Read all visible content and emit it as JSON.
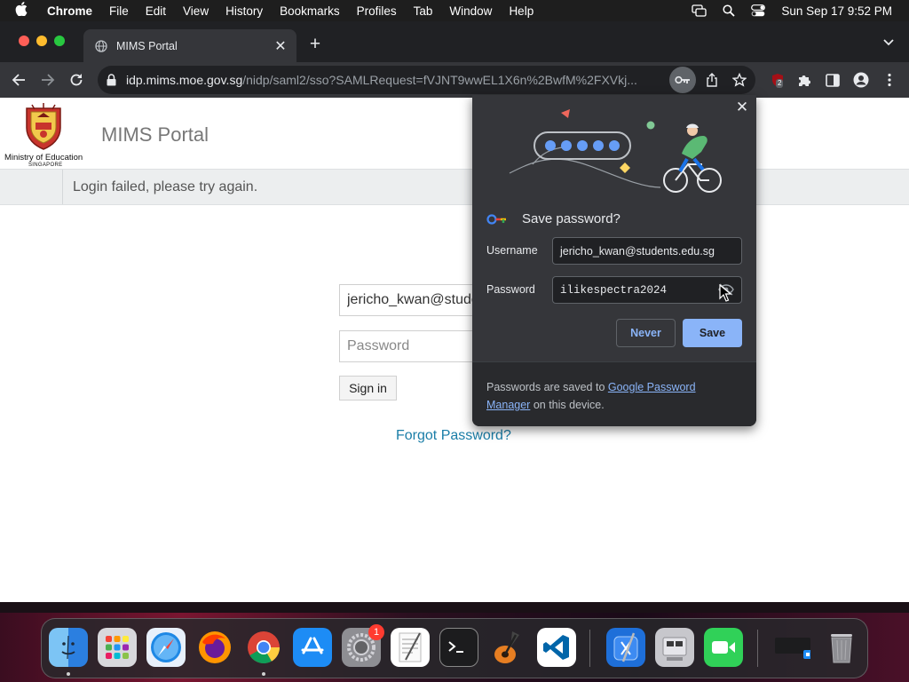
{
  "menubar": {
    "app_name": "Chrome",
    "items": [
      "File",
      "Edit",
      "View",
      "History",
      "Bookmarks",
      "Profiles",
      "Tab",
      "Window",
      "Help"
    ],
    "clock": "Sun Sep 17  9:52 PM"
  },
  "browser": {
    "tab_title": "MIMS Portal",
    "url_host": "idp.mims.moe.gov.sg",
    "url_path": "/nidp/saml2/sso?SAMLRequest=fVJNT9wwEL1X6n%2BwfM%2FXVkj...",
    "extension_badge": "2"
  },
  "page": {
    "org_name": "Ministry of Education",
    "org_country": "SINGAPORE",
    "portal_title": "MIMS Portal",
    "alert": "Login failed, please try again.",
    "username_value": "jericho_kwan@students.edu.sg",
    "password_placeholder": "Password",
    "signin_label": "Sign in",
    "forgot_label": "Forgot Password?"
  },
  "save_password_popup": {
    "title": "Save password?",
    "username_label": "Username",
    "username_value": "jericho_kwan@students.edu.sg",
    "password_label": "Password",
    "password_value": "ilikespectra2024",
    "never_label": "Never",
    "save_label": "Save",
    "footer_prefix": "Passwords are saved to ",
    "footer_link": "Google Password Manager",
    "footer_suffix": " on this device."
  },
  "dock": {
    "apps": [
      "finder-icon",
      "launchpad-icon",
      "safari-icon",
      "firefox-icon",
      "chrome-icon",
      "app-store-icon",
      "system-preferences-icon",
      "textedit-icon",
      "terminal-icon",
      "garageband-icon",
      "vscode-icon",
      "xcode-icon",
      "boot-camp-icon",
      "facetime-icon",
      "window-preview-icon",
      "trash-icon"
    ],
    "system_preferences_badge": "1"
  },
  "colors": {
    "accent_blue": "#8ab4f8",
    "link_teal": "#1b7ea8",
    "chrome_dark": "#35363a"
  }
}
